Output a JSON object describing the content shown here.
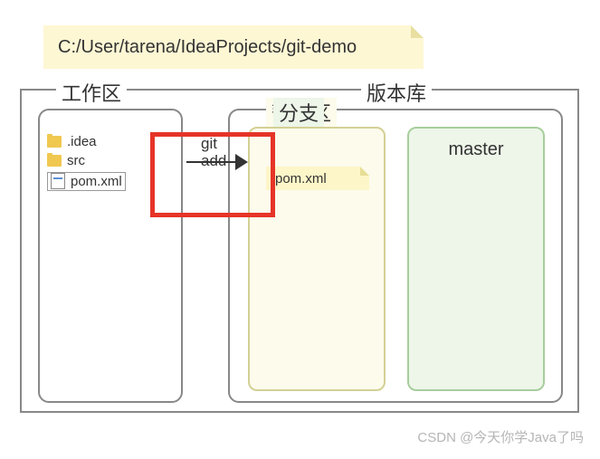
{
  "path_note": "C:/User/tarena/IdeaProjects/git-demo",
  "workspace": {
    "title": "工作区",
    "files": {
      "idea": ".idea",
      "src": "src",
      "pom": "pom.xml"
    }
  },
  "repo": {
    "title": "版本库",
    "stage": {
      "title": "暂存区",
      "file": "pom.xml"
    },
    "branch": {
      "title": "分支",
      "name": "master"
    }
  },
  "command": {
    "line1": "git",
    "line2": "add"
  },
  "watermark": "CSDN @今天你学Java了吗"
}
